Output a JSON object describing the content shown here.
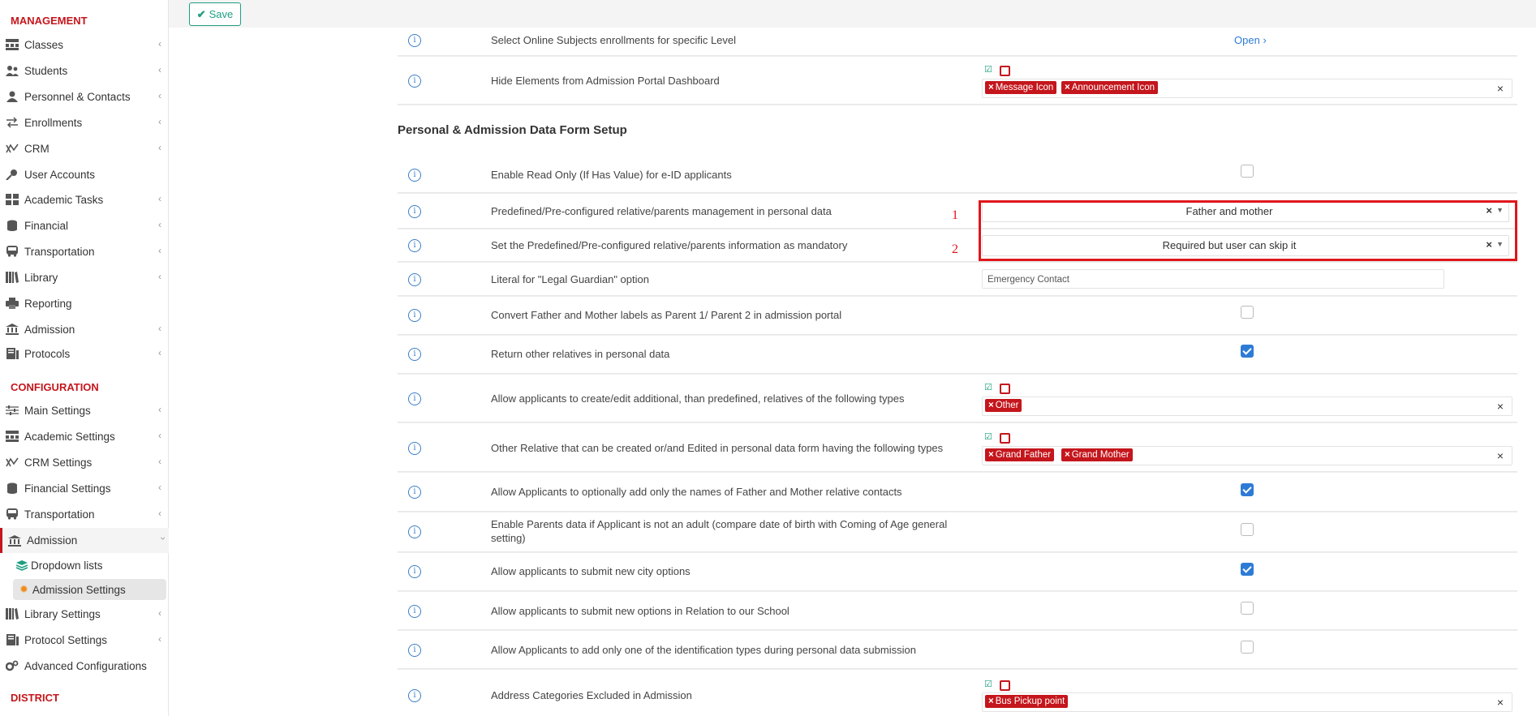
{
  "sidebar": {
    "management_title": "MANAGEMENT",
    "configuration_title": "CONFIGURATION",
    "district_title": "DISTRICT",
    "management_items": [
      {
        "label": "Classes",
        "icon": "classes-icon"
      },
      {
        "label": "Students",
        "icon": "students-icon"
      },
      {
        "label": "Personnel & Contacts",
        "icon": "personnel-icon"
      },
      {
        "label": "Enrollments",
        "icon": "enrollments-icon"
      },
      {
        "label": "CRM",
        "icon": "crm-icon"
      },
      {
        "label": "User Accounts",
        "icon": "key-icon"
      },
      {
        "label": "Academic Tasks",
        "icon": "tasks-icon"
      },
      {
        "label": "Financial",
        "icon": "coins-icon"
      },
      {
        "label": "Transportation",
        "icon": "bus-icon"
      },
      {
        "label": "Library",
        "icon": "library-icon"
      },
      {
        "label": "Reporting",
        "icon": "printer-icon"
      },
      {
        "label": "Admission",
        "icon": "bank-icon"
      },
      {
        "label": "Protocols",
        "icon": "protocols-icon"
      }
    ],
    "configuration_items": [
      {
        "label": "Main Settings",
        "icon": "sliders-icon"
      },
      {
        "label": "Academic Settings",
        "icon": "classes-icon"
      },
      {
        "label": "CRM Settings",
        "icon": "crm-icon"
      },
      {
        "label": "Financial Settings",
        "icon": "coins-icon"
      },
      {
        "label": "Transportation",
        "icon": "bus-icon"
      },
      {
        "label": "Admission",
        "icon": "bank-icon"
      },
      {
        "label": "Dropdown lists",
        "icon": "layers-icon"
      },
      {
        "label": "Admission Settings",
        "icon": "gear-icon"
      },
      {
        "label": "Library Settings",
        "icon": "library-icon"
      },
      {
        "label": "Protocol Settings",
        "icon": "protocols-icon"
      },
      {
        "label": "Advanced Configurations",
        "icon": "gears-icon"
      }
    ]
  },
  "toolbar": {
    "save_label": "Save"
  },
  "settings": {
    "row0_label": "Select Online Subjects enrollments for specific Level",
    "row0_link": "Open",
    "row1_label": "Hide Elements from Admission Portal Dashboard",
    "row1_tags": [
      "Message Icon",
      "Announcement Icon"
    ],
    "section_title": "Personal & Admission Data Form Setup",
    "row2_label": "Enable Read Only (If Has Value) for e-ID applicants",
    "row3_label": "Predefined/Pre-configured relative/parents management in personal data",
    "row3_value": "Father and mother",
    "row4_label": "Set the Predefined/Pre-configured relative/parents information as mandatory",
    "row4_value": "Required but user can skip it",
    "row5_label": "Literal for \"Legal Guardian\" option",
    "row5_value": "Emergency Contact",
    "row6_label": "Convert Father and Mother labels as Parent 1/ Parent 2 in admission portal",
    "row7_label": "Return other relatives in personal data",
    "row8_label": "Allow applicants to create/edit additional, than predefined, relatives of the following types",
    "row8_tags": [
      "Other"
    ],
    "row9_label": "Other Relative that can be created or/and Edited in personal data form having the following types",
    "row9_tags": [
      "Grand Father",
      "Grand Mother"
    ],
    "row10_label": "Allow Applicants to optionally add only the names of Father and Mother relative contacts",
    "row11_label": "Enable Parents data if Applicant is not an adult (compare date of birth with Coming of Age general setting)",
    "row12_label": "Allow applicants to submit new city options",
    "row13_label": "Allow applicants to submit new options in Relation to our School",
    "row14_label": "Allow Applicants to add only one of the identification types during personal data submission",
    "row15_label": "Address Categories Excluded in Admission",
    "row15_tags": [
      "Bus Pickup point"
    ]
  },
  "checkbox_states": {
    "row2": false,
    "row6": false,
    "row7": true,
    "row10": true,
    "row11": false,
    "row12": true,
    "row13": false,
    "row14": false
  },
  "annotations": {
    "one": "1",
    "two": "2"
  },
  "colors": {
    "brand_red": "#c4161c",
    "accent_blue": "#2e7bd6",
    "save_green": "#1e9e82",
    "annotation_red": "#e0161c"
  }
}
